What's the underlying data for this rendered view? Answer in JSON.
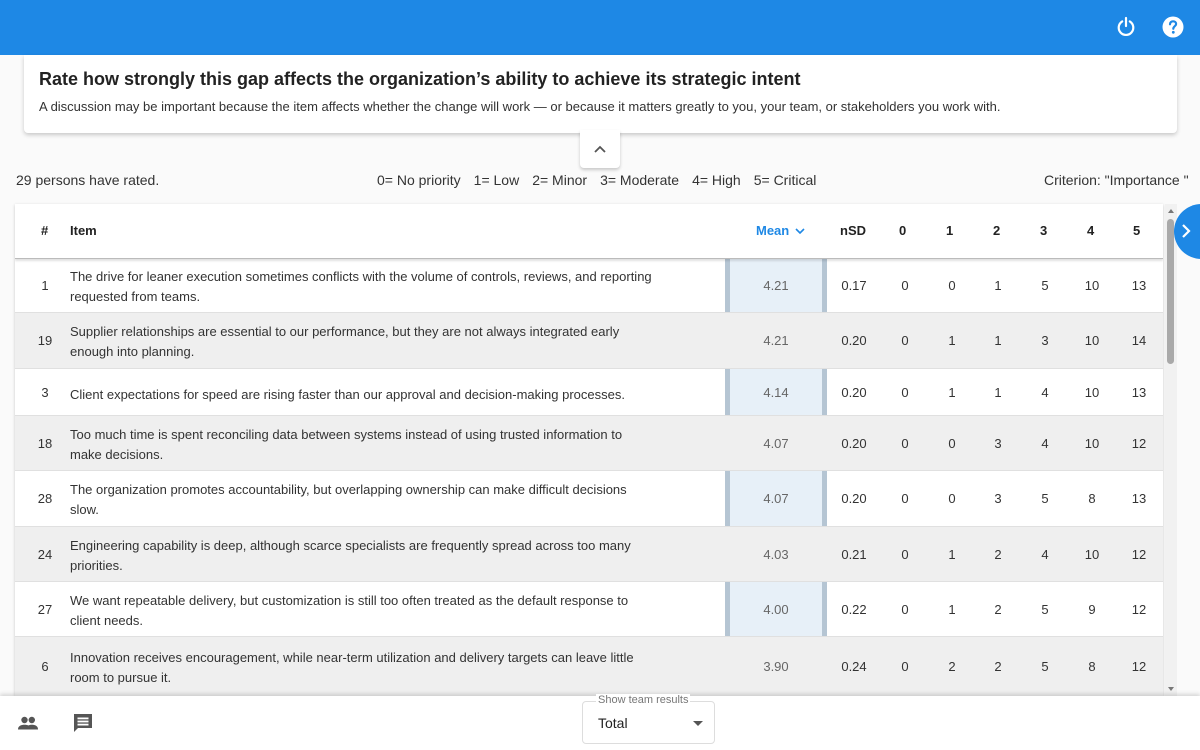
{
  "header": {
    "power_icon": "power-icon",
    "help_icon": "help-icon"
  },
  "question": {
    "title": "Rate how strongly this gap affects the organization’s ability to achieve its strategic intent",
    "description": "A discussion may be important because the item affects whether the change will work — or because it matters greatly to you, your team, or stakeholders you work with."
  },
  "summary": {
    "rated": "29 persons have rated.",
    "scale": [
      "0= No priority",
      "1= Low",
      "2= Minor",
      "3= Moderate",
      "4= High",
      "5= Critical"
    ],
    "criterion": "Criterion: \"Importance \""
  },
  "table": {
    "headers": {
      "num": "#",
      "item": "Item",
      "mean": "Mean",
      "nsd": "nSD",
      "c0": "0",
      "c1": "1",
      "c2": "2",
      "c3": "3",
      "c4": "4",
      "c5": "5"
    },
    "rows": [
      {
        "num": "1",
        "line1": "The drive for leaner execution sometimes conflicts with the volume of controls, reviews, and reporting",
        "line2": "requested from teams.",
        "mean": "4.21",
        "nsd": "0.17",
        "c0": "0",
        "c1": "0",
        "c2": "1",
        "c3": "5",
        "c4": "10",
        "c5": "13"
      },
      {
        "num": "19",
        "line1": "Supplier relationships are essential to our performance, but they are not always integrated early",
        "line2": "enough into planning.",
        "mean": "4.21",
        "nsd": "0.20",
        "c0": "0",
        "c1": "1",
        "c2": "1",
        "c3": "3",
        "c4": "10",
        "c5": "14"
      },
      {
        "num": "3",
        "line1": "Client expectations for speed are rising faster than our approval and decision-making processes.",
        "line2": "",
        "mean": "4.14",
        "nsd": "0.20",
        "c0": "0",
        "c1": "1",
        "c2": "1",
        "c3": "4",
        "c4": "10",
        "c5": "13"
      },
      {
        "num": "18",
        "line1": "Too much time is spent reconciling data between systems instead of using trusted information to",
        "line2": "make decisions.",
        "mean": "4.07",
        "nsd": "0.20",
        "c0": "0",
        "c1": "0",
        "c2": "3",
        "c3": "4",
        "c4": "10",
        "c5": "12"
      },
      {
        "num": "28",
        "line1": "The organization promotes accountability, but overlapping ownership can make difficult decisions",
        "line2": "slow.",
        "mean": "4.07",
        "nsd": "0.20",
        "c0": "0",
        "c1": "0",
        "c2": "3",
        "c3": "5",
        "c4": "8",
        "c5": "13"
      },
      {
        "num": "24",
        "line1": "Engineering capability is deep, although scarce specialists are frequently spread across too many",
        "line2": "priorities.",
        "mean": "4.03",
        "nsd": "0.21",
        "c0": "0",
        "c1": "1",
        "c2": "2",
        "c3": "4",
        "c4": "10",
        "c5": "12"
      },
      {
        "num": "27",
        "line1": "We want repeatable delivery, but customization is still too often treated as the default response to",
        "line2": "client needs.",
        "mean": "4.00",
        "nsd": "0.22",
        "c0": "0",
        "c1": "1",
        "c2": "2",
        "c3": "5",
        "c4": "9",
        "c5": "12"
      },
      {
        "num": "6",
        "line1": "Innovation receives encouragement, while near-term utilization and delivery targets can leave little",
        "line2": "room to pursue it.",
        "mean": "3.90",
        "nsd": "0.24",
        "c0": "0",
        "c1": "2",
        "c2": "2",
        "c3": "5",
        "c4": "8",
        "c5": "12"
      }
    ]
  },
  "footer": {
    "team_icon": "people-icon",
    "comment_icon": "comment-icon",
    "select_label": "Show team results",
    "select_value": "Total"
  },
  "colors": {
    "primary": "#1e88e5",
    "mean_column": "#e7f0f8"
  }
}
